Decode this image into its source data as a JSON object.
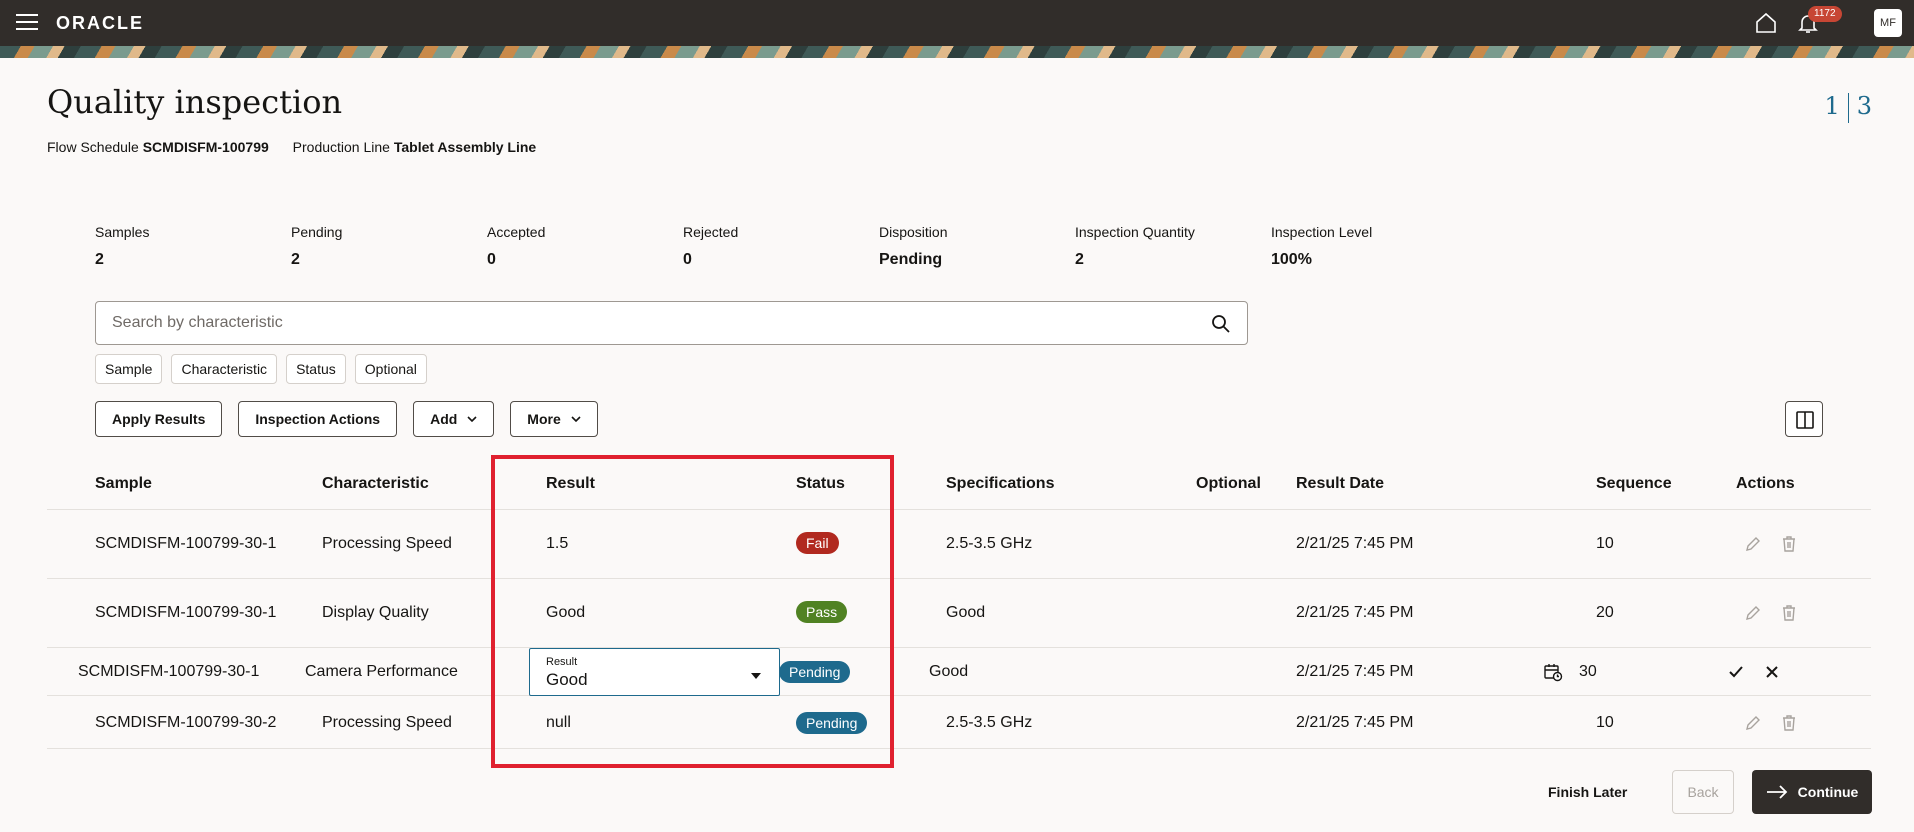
{
  "topbar": {
    "brand": "ORACLE",
    "notification_count": "1172",
    "avatar_initials": "MF"
  },
  "header": {
    "title": "Quality inspection",
    "flow_schedule_label": "Flow Schedule",
    "flow_schedule_value": "SCMDISFM-100799",
    "production_line_label": "Production Line",
    "production_line_value": "Tablet Assembly Line",
    "step_current": "1",
    "step_total": "3"
  },
  "summary": [
    {
      "label": "Samples",
      "value": "2"
    },
    {
      "label": "Pending",
      "value": "2"
    },
    {
      "label": "Accepted",
      "value": "0"
    },
    {
      "label": "Rejected",
      "value": "0"
    },
    {
      "label": "Disposition",
      "value": "Pending"
    },
    {
      "label": "Inspection Quantity",
      "value": "2"
    },
    {
      "label": "Inspection Level",
      "value": "100%"
    }
  ],
  "search": {
    "placeholder": "Search by characteristic"
  },
  "filters": [
    "Sample",
    "Characteristic",
    "Status",
    "Optional"
  ],
  "toolbar": {
    "apply_results": "Apply Results",
    "inspection_actions": "Inspection Actions",
    "add": "Add",
    "more": "More"
  },
  "table": {
    "columns": [
      "Sample",
      "Characteristic",
      "Result",
      "Status",
      "Specifications",
      "Optional",
      "Result Date",
      "Sequence",
      "Actions"
    ],
    "rows": [
      {
        "sample": "SCMDISFM-100799-30-1",
        "characteristic": "Processing Speed",
        "result": "1.5",
        "status": "Fail",
        "specifications": "2.5-3.5 GHz",
        "optional": "",
        "result_date": "2/21/25 7:45 PM",
        "sequence": "10"
      },
      {
        "sample": "SCMDISFM-100799-30-1",
        "characteristic": "Display Quality",
        "result": "Good",
        "status": "Pass",
        "specifications": "Good",
        "optional": "",
        "result_date": "2/21/25 7:45 PM",
        "sequence": "20"
      },
      {
        "sample": "SCMDISFM-100799-30-1",
        "characteristic": "Camera Performance",
        "result_field_label": "Result",
        "result": "Good",
        "status": "Pending",
        "specifications": "Good",
        "optional": "",
        "result_date": "2/21/25 7:45 PM",
        "sequence": "30"
      },
      {
        "sample": "SCMDISFM-100799-30-2",
        "characteristic": "Processing Speed",
        "result": "null",
        "status": "Pending",
        "specifications": "2.5-3.5 GHz",
        "optional": "",
        "result_date": "2/21/25 7:45 PM",
        "sequence": "10"
      }
    ]
  },
  "footer": {
    "finish_later": "Finish Later",
    "back": "Back",
    "continue": "Continue"
  },
  "colors": {
    "fail": "#b1291f",
    "pass": "#508223",
    "pending": "#1e6a8d",
    "highlight": "#e0212f",
    "topbar": "#312d2a"
  }
}
